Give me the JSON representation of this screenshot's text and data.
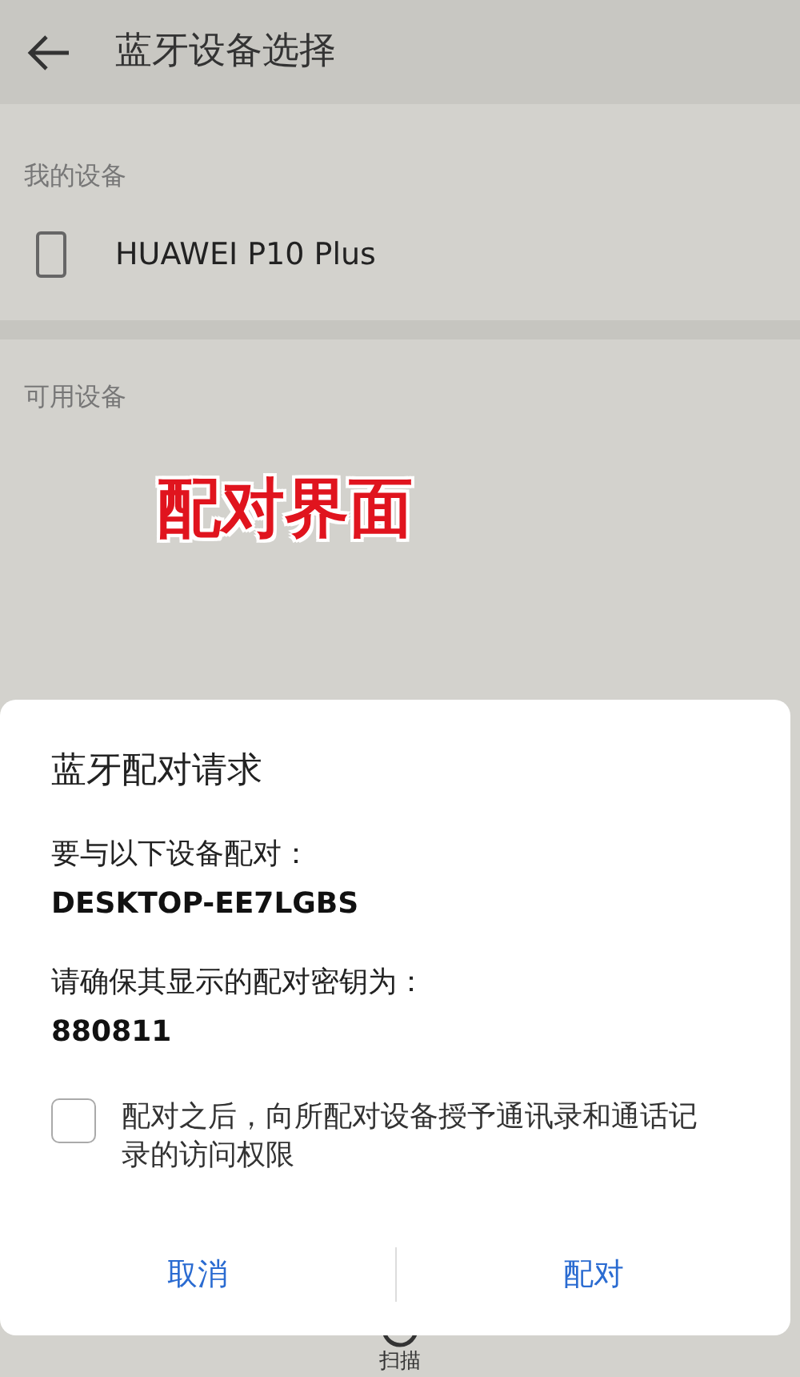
{
  "header": {
    "title": "蓝牙设备选择"
  },
  "my_devices": {
    "heading": "我的设备",
    "items": [
      {
        "name": "HUAWEI P10 Plus"
      }
    ]
  },
  "available_devices": {
    "heading": "可用设备"
  },
  "annotation": "配对界面",
  "bottom_bar": {
    "label": "扫描"
  },
  "dialog": {
    "title": "蓝牙配对请求",
    "pair_prompt": "要与以下设备配对：",
    "device_name": "DESKTOP-EE7LGBS",
    "key_prompt": "请确保其显示的配对密钥为：",
    "key": "880811",
    "permission": {
      "label": "配对之后，向所配对设备授予通讯录和通话记录的访问权限",
      "checked": false
    },
    "buttons": [
      "取消",
      "配对"
    ]
  }
}
